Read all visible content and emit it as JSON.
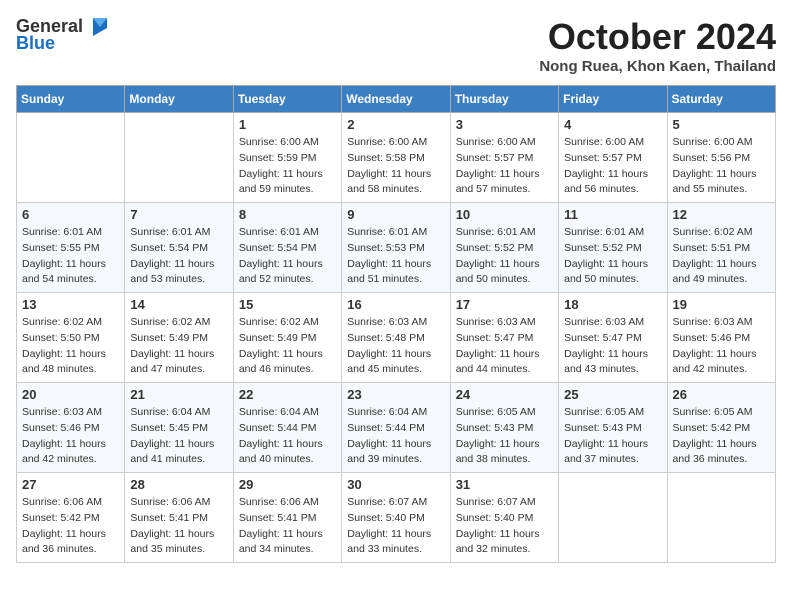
{
  "logo": {
    "general": "General",
    "blue": "Blue"
  },
  "title": "October 2024",
  "location": "Nong Ruea, Khon Kaen, Thailand",
  "days_of_week": [
    "Sunday",
    "Monday",
    "Tuesday",
    "Wednesday",
    "Thursday",
    "Friday",
    "Saturday"
  ],
  "weeks": [
    [
      {
        "day": "",
        "info": ""
      },
      {
        "day": "",
        "info": ""
      },
      {
        "day": "1",
        "info": "Sunrise: 6:00 AM\nSunset: 5:59 PM\nDaylight: 11 hours and 59 minutes."
      },
      {
        "day": "2",
        "info": "Sunrise: 6:00 AM\nSunset: 5:58 PM\nDaylight: 11 hours and 58 minutes."
      },
      {
        "day": "3",
        "info": "Sunrise: 6:00 AM\nSunset: 5:57 PM\nDaylight: 11 hours and 57 minutes."
      },
      {
        "day": "4",
        "info": "Sunrise: 6:00 AM\nSunset: 5:57 PM\nDaylight: 11 hours and 56 minutes."
      },
      {
        "day": "5",
        "info": "Sunrise: 6:00 AM\nSunset: 5:56 PM\nDaylight: 11 hours and 55 minutes."
      }
    ],
    [
      {
        "day": "6",
        "info": "Sunrise: 6:01 AM\nSunset: 5:55 PM\nDaylight: 11 hours and 54 minutes."
      },
      {
        "day": "7",
        "info": "Sunrise: 6:01 AM\nSunset: 5:54 PM\nDaylight: 11 hours and 53 minutes."
      },
      {
        "day": "8",
        "info": "Sunrise: 6:01 AM\nSunset: 5:54 PM\nDaylight: 11 hours and 52 minutes."
      },
      {
        "day": "9",
        "info": "Sunrise: 6:01 AM\nSunset: 5:53 PM\nDaylight: 11 hours and 51 minutes."
      },
      {
        "day": "10",
        "info": "Sunrise: 6:01 AM\nSunset: 5:52 PM\nDaylight: 11 hours and 50 minutes."
      },
      {
        "day": "11",
        "info": "Sunrise: 6:01 AM\nSunset: 5:52 PM\nDaylight: 11 hours and 50 minutes."
      },
      {
        "day": "12",
        "info": "Sunrise: 6:02 AM\nSunset: 5:51 PM\nDaylight: 11 hours and 49 minutes."
      }
    ],
    [
      {
        "day": "13",
        "info": "Sunrise: 6:02 AM\nSunset: 5:50 PM\nDaylight: 11 hours and 48 minutes."
      },
      {
        "day": "14",
        "info": "Sunrise: 6:02 AM\nSunset: 5:49 PM\nDaylight: 11 hours and 47 minutes."
      },
      {
        "day": "15",
        "info": "Sunrise: 6:02 AM\nSunset: 5:49 PM\nDaylight: 11 hours and 46 minutes."
      },
      {
        "day": "16",
        "info": "Sunrise: 6:03 AM\nSunset: 5:48 PM\nDaylight: 11 hours and 45 minutes."
      },
      {
        "day": "17",
        "info": "Sunrise: 6:03 AM\nSunset: 5:47 PM\nDaylight: 11 hours and 44 minutes."
      },
      {
        "day": "18",
        "info": "Sunrise: 6:03 AM\nSunset: 5:47 PM\nDaylight: 11 hours and 43 minutes."
      },
      {
        "day": "19",
        "info": "Sunrise: 6:03 AM\nSunset: 5:46 PM\nDaylight: 11 hours and 42 minutes."
      }
    ],
    [
      {
        "day": "20",
        "info": "Sunrise: 6:03 AM\nSunset: 5:46 PM\nDaylight: 11 hours and 42 minutes."
      },
      {
        "day": "21",
        "info": "Sunrise: 6:04 AM\nSunset: 5:45 PM\nDaylight: 11 hours and 41 minutes."
      },
      {
        "day": "22",
        "info": "Sunrise: 6:04 AM\nSunset: 5:44 PM\nDaylight: 11 hours and 40 minutes."
      },
      {
        "day": "23",
        "info": "Sunrise: 6:04 AM\nSunset: 5:44 PM\nDaylight: 11 hours and 39 minutes."
      },
      {
        "day": "24",
        "info": "Sunrise: 6:05 AM\nSunset: 5:43 PM\nDaylight: 11 hours and 38 minutes."
      },
      {
        "day": "25",
        "info": "Sunrise: 6:05 AM\nSunset: 5:43 PM\nDaylight: 11 hours and 37 minutes."
      },
      {
        "day": "26",
        "info": "Sunrise: 6:05 AM\nSunset: 5:42 PM\nDaylight: 11 hours and 36 minutes."
      }
    ],
    [
      {
        "day": "27",
        "info": "Sunrise: 6:06 AM\nSunset: 5:42 PM\nDaylight: 11 hours and 36 minutes."
      },
      {
        "day": "28",
        "info": "Sunrise: 6:06 AM\nSunset: 5:41 PM\nDaylight: 11 hours and 35 minutes."
      },
      {
        "day": "29",
        "info": "Sunrise: 6:06 AM\nSunset: 5:41 PM\nDaylight: 11 hours and 34 minutes."
      },
      {
        "day": "30",
        "info": "Sunrise: 6:07 AM\nSunset: 5:40 PM\nDaylight: 11 hours and 33 minutes."
      },
      {
        "day": "31",
        "info": "Sunrise: 6:07 AM\nSunset: 5:40 PM\nDaylight: 11 hours and 32 minutes."
      },
      {
        "day": "",
        "info": ""
      },
      {
        "day": "",
        "info": ""
      }
    ]
  ]
}
